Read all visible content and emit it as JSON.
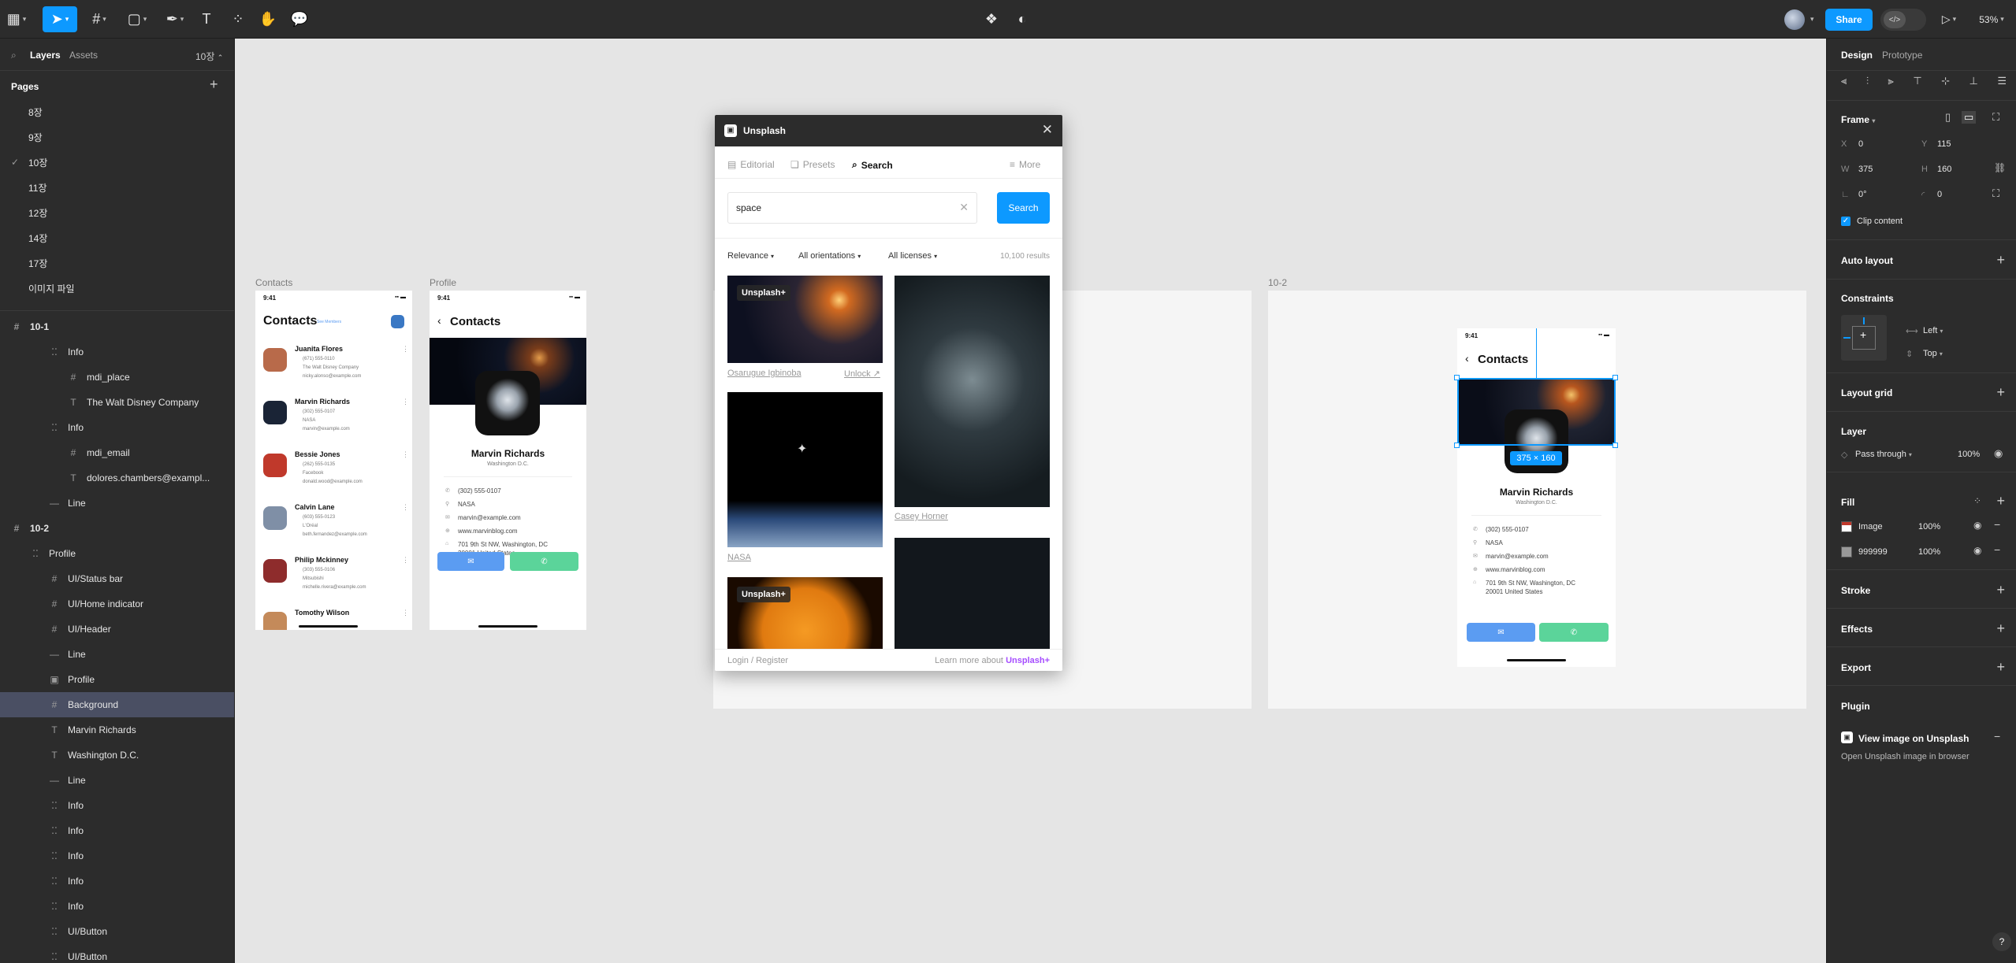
{
  "toolbar": {
    "center_icons": [
      "component-icon",
      "theme-icon"
    ],
    "share_label": "Share",
    "zoom": "53%"
  },
  "left_panel": {
    "tabs": [
      "Layers",
      "Assets"
    ],
    "page_selector": "10장",
    "pages_title": "Pages",
    "pages": [
      "8장",
      "9장",
      "10장",
      "11장",
      "12장",
      "14장",
      "17장",
      "이미지 파일"
    ],
    "current_page": "10장",
    "layers": [
      {
        "label": "10-1",
        "type": "frame",
        "indent": 0
      },
      {
        "label": "Info",
        "type": "autolayout",
        "indent": 2
      },
      {
        "label": "mdi_place",
        "type": "frame",
        "indent": 3
      },
      {
        "label": "The Walt Disney Company",
        "type": "text",
        "indent": 3
      },
      {
        "label": "Info",
        "type": "autolayout",
        "indent": 2
      },
      {
        "label": "mdi_email",
        "type": "frame",
        "indent": 3
      },
      {
        "label": "dolores.chambers@exampl...",
        "type": "text",
        "indent": 3
      },
      {
        "label": "Line",
        "type": "line",
        "indent": 2
      },
      {
        "label": "10-2",
        "type": "frame",
        "indent": 0
      },
      {
        "label": "Profile",
        "type": "autolayout",
        "indent": 1
      },
      {
        "label": "UI/Status bar",
        "type": "frame",
        "indent": 2
      },
      {
        "label": "UI/Home indicator",
        "type": "frame",
        "indent": 2
      },
      {
        "label": "UI/Header",
        "type": "frame",
        "indent": 2
      },
      {
        "label": "Line",
        "type": "line",
        "indent": 2
      },
      {
        "label": "Profile",
        "type": "image",
        "indent": 2
      },
      {
        "label": "Background",
        "type": "frame",
        "indent": 2,
        "selected": true
      },
      {
        "label": "Marvin Richards",
        "type": "text",
        "indent": 2
      },
      {
        "label": "Washington D.C.",
        "type": "text",
        "indent": 2
      },
      {
        "label": "Line",
        "type": "line",
        "indent": 2
      },
      {
        "label": "Info",
        "type": "autolayout",
        "indent": 2
      },
      {
        "label": "Info",
        "type": "autolayout",
        "indent": 2
      },
      {
        "label": "Info",
        "type": "autolayout",
        "indent": 2
      },
      {
        "label": "Info",
        "type": "autolayout",
        "indent": 2
      },
      {
        "label": "Info",
        "type": "autolayout",
        "indent": 2
      },
      {
        "label": "UI/Button",
        "type": "autolayout",
        "indent": 2
      },
      {
        "label": "UI/Button",
        "type": "autolayout",
        "indent": 2
      }
    ]
  },
  "canvas": {
    "frame_labels": {
      "contacts": "Contacts",
      "profile": "Profile",
      "ten_two": "10-2"
    },
    "status_time": "9:41",
    "contacts_title": "Contacts",
    "contacts_link": "See Members",
    "contacts": [
      {
        "name": "Juanita Flores",
        "phone": "(671) 555-0110",
        "company": "The Walt Disney Company",
        "email": "nicky.alonso@example.com",
        "color": "#b86a4a"
      },
      {
        "name": "Marvin Richards",
        "phone": "(302) 555-0107",
        "company": "NASA",
        "email": "marvin@example.com",
        "color": "#1a2436"
      },
      {
        "name": "Bessie Jones",
        "phone": "(262) 555-0135",
        "company": "Facebook",
        "email": "donald.wood@example.com",
        "color": "#c0392b"
      },
      {
        "name": "Calvin Lane",
        "phone": "(603) 555-0123",
        "company": "L'Oréal",
        "email": "beth.fernandez@example.com",
        "color": "#7f8fa6"
      },
      {
        "name": "Philip Mckinney",
        "phone": "(303) 555-0106",
        "company": "Mitsubishi",
        "email": "michelle.rivera@example.com",
        "color": "#8e2c2c"
      },
      {
        "name": "Tomothy Wilson",
        "phone": "",
        "company": "",
        "email": "",
        "color": "#c48a5a"
      }
    ],
    "profile": {
      "title": "Contacts",
      "name": "Marvin Richards",
      "location": "Washington D.C.",
      "info": [
        "(302) 555-0107",
        "NASA",
        "marvin@example.com",
        "www.marvinblog.com",
        "701 9th St NW, Washington, DC",
        "20001 United States"
      ]
    },
    "selection_size": "375 × 160"
  },
  "unsplash": {
    "title": "Unsplash",
    "tabs": [
      "Editorial",
      "Presets",
      "Search"
    ],
    "active_tab": "Search",
    "more": "More",
    "query": "space",
    "search_button": "Search",
    "filters": [
      "Relevance",
      "All orientations",
      "All licenses"
    ],
    "results": "10,100 results",
    "badge": "Unsplash+",
    "captions": {
      "author1": "Osarugue Igbinoba",
      "unlock": "Unlock ↗",
      "author2": "Casey Horner",
      "author3": "NASA"
    },
    "footer_left": "Login / Register",
    "footer_right": "Learn more about",
    "footer_brand": "Unsplash+"
  },
  "right_panel": {
    "tabs": [
      "Design",
      "Prototype"
    ],
    "frame_label": "Frame",
    "x": "0",
    "y": "115",
    "w": "375",
    "h": "160",
    "rotation": "0°",
    "radius": "0",
    "clip_content": "Clip content",
    "sections": {
      "auto_layout": "Auto layout",
      "constraints": "Constraints",
      "layout_grid": "Layout grid",
      "layer": "Layer",
      "fill": "Fill",
      "stroke": "Stroke",
      "effects": "Effects",
      "export": "Export",
      "plugin": "Plugin"
    },
    "constraint_h": "Left",
    "constraint_v": "Top",
    "blend": "Pass through",
    "opacity": "100%",
    "fills": [
      {
        "name": "Image",
        "opacity": "100%"
      },
      {
        "name": "999999",
        "opacity": "100%",
        "color": "#999999"
      }
    ],
    "plugin_title": "View image on Unsplash",
    "plugin_sub": "Open Unsplash image in browser",
    "help": "?"
  },
  "colors": {
    "accent": "#0d99ff",
    "call_button": "#5bd49a",
    "mail_button": "#5b9cf2"
  }
}
